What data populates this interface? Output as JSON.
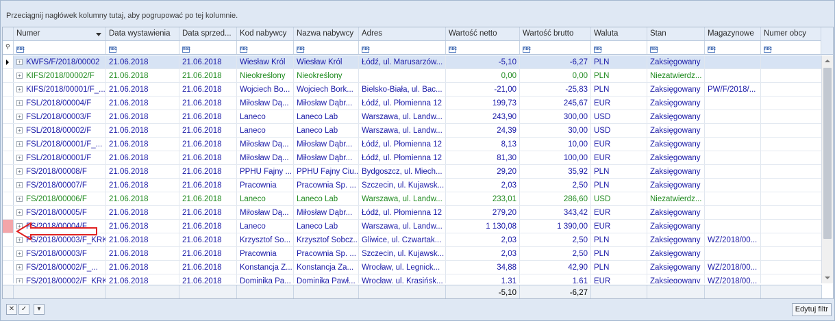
{
  "group_panel_text": "Przeciągnij nagłówek kolumny tutaj, aby pogrupować po tej kolumnie.",
  "columns": [
    {
      "key": "numer",
      "label": "Numer",
      "width": 135
    },
    {
      "key": "data_wyst",
      "label": "Data wystawienia",
      "width": 107
    },
    {
      "key": "data_sprz",
      "label": "Data sprzed...",
      "width": 84
    },
    {
      "key": "kod",
      "label": "Kod nabywcy",
      "width": 83
    },
    {
      "key": "nazwa",
      "label": "Nazwa nabywcy",
      "width": 95
    },
    {
      "key": "adres",
      "label": "Adres",
      "width": 127
    },
    {
      "key": "netto",
      "label": "Wartość netto",
      "width": 108
    },
    {
      "key": "brutto",
      "label": "Wartość brutto",
      "width": 104
    },
    {
      "key": "waluta",
      "label": "Waluta",
      "width": 82
    },
    {
      "key": "stan",
      "label": "Stan",
      "width": 84
    },
    {
      "key": "magazyn",
      "label": "Magazynowe",
      "width": 82
    },
    {
      "key": "obcy",
      "label": "Numer obcy",
      "width": 89
    }
  ],
  "filter_icon_text": "RBC",
  "rows": [
    {
      "numer": "KWFS/F/2018/00002",
      "data_wyst": "21.06.2018",
      "data_sprz": "21.06.2018",
      "kod": "Wiesław Król",
      "nazwa": "Wiesław Król",
      "adres": "Łódź, ul. Marusarzów...",
      "netto": "-5,10",
      "brutto": "-6,27",
      "waluta": "PLN",
      "stan": "Zaksięgowany",
      "magazyn": "",
      "obcy": "",
      "green": false,
      "selected": true
    },
    {
      "numer": "KIFS/2018/00002/F",
      "data_wyst": "21.06.2018",
      "data_sprz": "21.06.2018",
      "kod": "Nieokreślony",
      "nazwa": "Nieokreślony",
      "adres": "",
      "netto": "0,00",
      "brutto": "0,00",
      "waluta": "PLN",
      "stan": "Niezatwierdz...",
      "magazyn": "",
      "obcy": "",
      "green": true
    },
    {
      "numer": "KIFS/2018/00001/F_...",
      "data_wyst": "21.06.2018",
      "data_sprz": "21.06.2018",
      "kod": "Wojciech Bo...",
      "nazwa": "Wojciech Bork...",
      "adres": "Bielsko-Biała, ul. Bac...",
      "netto": "-21,00",
      "brutto": "-25,83",
      "waluta": "PLN",
      "stan": "Zaksięgowany",
      "magazyn": "PW/F/2018/...",
      "obcy": "",
      "green": false
    },
    {
      "numer": "FSL/2018/00004/F",
      "data_wyst": "21.06.2018",
      "data_sprz": "21.06.2018",
      "kod": "Miłosław Dą...",
      "nazwa": "Miłosław Dąbr...",
      "adres": "Łódź, ul. Płomienna 12",
      "netto": "199,73",
      "brutto": "245,67",
      "waluta": "EUR",
      "stan": "Zaksięgowany",
      "magazyn": "",
      "obcy": "",
      "green": false
    },
    {
      "numer": "FSL/2018/00003/F",
      "data_wyst": "21.06.2018",
      "data_sprz": "21.06.2018",
      "kod": "Laneco",
      "nazwa": "Laneco Lab",
      "adres": "Warszawa, ul. Landw...",
      "netto": "243,90",
      "brutto": "300,00",
      "waluta": "USD",
      "stan": "Zaksięgowany",
      "magazyn": "",
      "obcy": "",
      "green": false
    },
    {
      "numer": "FSL/2018/00002/F",
      "data_wyst": "21.06.2018",
      "data_sprz": "21.06.2018",
      "kod": "Laneco",
      "nazwa": "Laneco Lab",
      "adres": "Warszawa, ul. Landw...",
      "netto": "24,39",
      "brutto": "30,00",
      "waluta": "USD",
      "stan": "Zaksięgowany",
      "magazyn": "",
      "obcy": "",
      "green": false
    },
    {
      "numer": "FSL/2018/00001/F_...",
      "data_wyst": "21.06.2018",
      "data_sprz": "21.06.2018",
      "kod": "Miłosław Dą...",
      "nazwa": "Miłosław Dąbr...",
      "adres": "Łódź, ul. Płomienna 12",
      "netto": "8,13",
      "brutto": "10,00",
      "waluta": "EUR",
      "stan": "Zaksięgowany",
      "magazyn": "",
      "obcy": "",
      "green": false
    },
    {
      "numer": "FSL/2018/00001/F",
      "data_wyst": "21.06.2018",
      "data_sprz": "21.06.2018",
      "kod": "Miłosław Dą...",
      "nazwa": "Miłosław Dąbr...",
      "adres": "Łódź, ul. Płomienna 12",
      "netto": "81,30",
      "brutto": "100,00",
      "waluta": "EUR",
      "stan": "Zaksięgowany",
      "magazyn": "",
      "obcy": "",
      "green": false
    },
    {
      "numer": "FS/2018/00008/F",
      "data_wyst": "21.06.2018",
      "data_sprz": "21.06.2018",
      "kod": "PPHU Fajny ...",
      "nazwa": "PPHU Fajny Ciu...",
      "adres": "Bydgoszcz, ul. Miech...",
      "netto": "29,20",
      "brutto": "35,92",
      "waluta": "PLN",
      "stan": "Zaksięgowany",
      "magazyn": "",
      "obcy": "",
      "green": false
    },
    {
      "numer": "FS/2018/00007/F",
      "data_wyst": "21.06.2018",
      "data_sprz": "21.06.2018",
      "kod": "Pracownia",
      "nazwa": "Pracownia Sp. ...",
      "adres": "Szczecin, ul. Kujawsk...",
      "netto": "2,03",
      "brutto": "2,50",
      "waluta": "PLN",
      "stan": "Zaksięgowany",
      "magazyn": "",
      "obcy": "",
      "green": false
    },
    {
      "numer": "FS/2018/00006/F",
      "data_wyst": "21.06.2018",
      "data_sprz": "21.06.2018",
      "kod": "Laneco",
      "nazwa": "Laneco Lab",
      "adres": "Warszawa, ul. Landw...",
      "netto": "233,01",
      "brutto": "286,60",
      "waluta": "USD",
      "stan": "Niezatwierdz...",
      "magazyn": "",
      "obcy": "",
      "green": true
    },
    {
      "numer": "FS/2018/00005/F",
      "data_wyst": "21.06.2018",
      "data_sprz": "21.06.2018",
      "kod": "Miłosław Dą...",
      "nazwa": "Miłosław Dąbr...",
      "adres": "Łódź, ul. Płomienna 12",
      "netto": "279,20",
      "brutto": "343,42",
      "waluta": "EUR",
      "stan": "Zaksięgowany",
      "magazyn": "",
      "obcy": "",
      "green": false
    },
    {
      "numer": "FS/2018/00004/F",
      "data_wyst": "21.06.2018",
      "data_sprz": "21.06.2018",
      "kod": "Laneco",
      "nazwa": "Laneco Lab",
      "adres": "Warszawa, ul. Landw...",
      "netto": "1 130,08",
      "brutto": "1 390,00",
      "waluta": "EUR",
      "stan": "Zaksięgowany",
      "magazyn": "",
      "obcy": "",
      "green": false,
      "marked": true
    },
    {
      "numer": "FS/2018/00003/F_KRK",
      "data_wyst": "21.06.2018",
      "data_sprz": "21.06.2018",
      "kod": "Krzysztof So...",
      "nazwa": "Krzysztof Sobcz...",
      "adres": "Gliwice, ul. Czwartak...",
      "netto": "2,03",
      "brutto": "2,50",
      "waluta": "PLN",
      "stan": "Zaksięgowany",
      "magazyn": "WZ/2018/00...",
      "obcy": "",
      "green": false
    },
    {
      "numer": "FS/2018/00003/F",
      "data_wyst": "21.06.2018",
      "data_sprz": "21.06.2018",
      "kod": "Pracownia",
      "nazwa": "Pracownia Sp. ...",
      "adres": "Szczecin, ul. Kujawsk...",
      "netto": "2,03",
      "brutto": "2,50",
      "waluta": "PLN",
      "stan": "Zaksięgowany",
      "magazyn": "",
      "obcy": "",
      "green": false
    },
    {
      "numer": "FS/2018/00002/F_...",
      "data_wyst": "21.06.2018",
      "data_sprz": "21.06.2018",
      "kod": "Konstancja Z...",
      "nazwa": "Konstancja Za...",
      "adres": "Wrocław, ul. Legnick...",
      "netto": "34,88",
      "brutto": "42,90",
      "waluta": "PLN",
      "stan": "Zaksięgowany",
      "magazyn": "WZ/2018/00...",
      "obcy": "",
      "green": false
    },
    {
      "numer": "FS/2018/00002/F_KRK",
      "data_wyst": "21.06.2018",
      "data_sprz": "21.06.2018",
      "kod": "Dominika Pa...",
      "nazwa": "Dominika Pawł...",
      "adres": "Wrocław, ul. Krasińsk...",
      "netto": "1,31",
      "brutto": "1,61",
      "waluta": "EUR",
      "stan": "Zaksięgowany",
      "magazyn": "WZ/2018/00...",
      "obcy": "",
      "green": false
    }
  ],
  "footer": {
    "netto_sum": "-5,10",
    "brutto_sum": "-6,27"
  },
  "bottom": {
    "clear_label": "✕",
    "check_label": "✓",
    "dropdown_label": "▾",
    "edit_filter_label": "Edytuj filtr"
  },
  "colors": {
    "blue_text": "#1a1aa8",
    "green_text": "#1f8a1f",
    "mark": "#f3a5a9",
    "arrow": "#e02020"
  }
}
